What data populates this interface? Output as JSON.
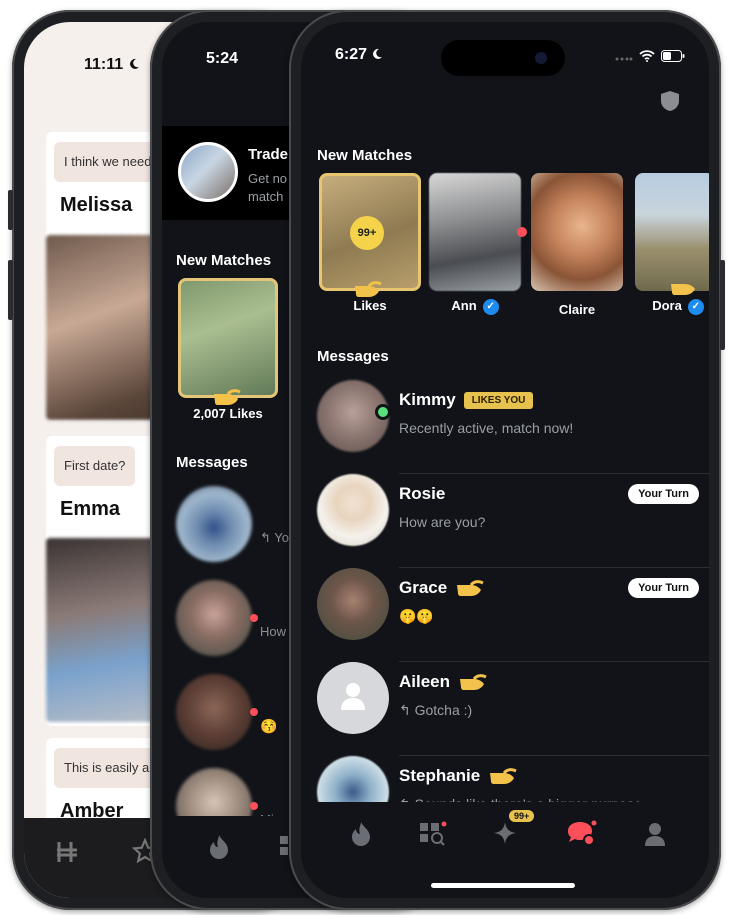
{
  "back_phone": {
    "status_time": "11:11",
    "cards": [
      {
        "quote": "I think we need t",
        "name": "Melissa"
      },
      {
        "quote": "First date?",
        "name": "Emma"
      },
      {
        "quote": "This is easily a p",
        "name": "Amber"
      }
    ]
  },
  "middle_phone": {
    "status_time": "5:24",
    "banner": {
      "title": "Trade",
      "subtitle_line1": "Get no",
      "subtitle_line2": "match"
    },
    "new_matches_title": "New Matches",
    "likes_label": "2,007 Likes",
    "messages_title": "Messages",
    "previews": [
      "↰ Yo",
      "How",
      "😚",
      "Mix"
    ]
  },
  "front_phone": {
    "status_time": "6:27",
    "new_matches_title": "New Matches",
    "likes_count": "99+",
    "likes_label": "Likes",
    "matches": [
      {
        "name": "Ann",
        "verified": true
      },
      {
        "name": "Claire",
        "verified": false
      },
      {
        "name": "Dora",
        "verified": true
      }
    ],
    "messages_title": "Messages",
    "messages": [
      {
        "name": "Kimmy",
        "badge": "LIKES YOU",
        "preview": "Recently active, match now!",
        "your_turn": ""
      },
      {
        "name": "Rosie",
        "badge": "",
        "preview": "How are you?",
        "your_turn": "Your Turn"
      },
      {
        "name": "Grace",
        "badge": "",
        "preview": "🤫🤫",
        "your_turn": "Your Turn"
      },
      {
        "name": "Aileen",
        "badge": "",
        "preview": "↰ Gotcha :)",
        "your_turn": ""
      },
      {
        "name": "Stephanie",
        "badge": "",
        "preview": "↰ Sounds like there’s a bigger purpose…",
        "your_turn": ""
      }
    ],
    "tabbar": {
      "explore_count": "99+",
      "active_tab": "chat"
    }
  },
  "colors": {
    "background_dark": "#111318",
    "gold": "#e8c24e",
    "accent_red": "#fd4f5a",
    "verified_blue": "#1d8cf0",
    "online_green": "#58e07c"
  },
  "icons": [
    "moon-icon",
    "wifi-icon",
    "battery-icon",
    "shield-icon",
    "flame-icon",
    "explore-icon",
    "sparkle-icon",
    "chat-icon",
    "profile-icon",
    "verified-icon",
    "hand-icon",
    "reply-icon"
  ]
}
